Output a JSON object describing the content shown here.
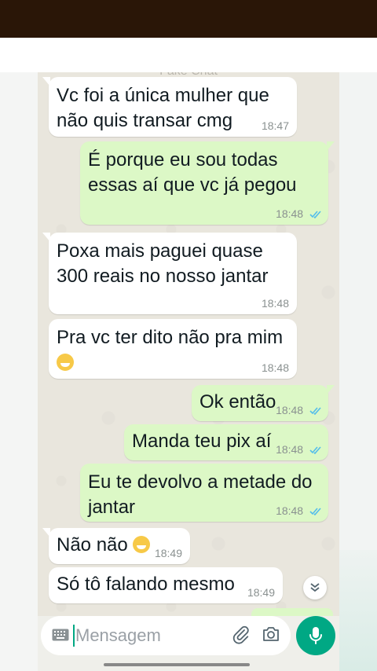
{
  "contact": {
    "name": "Fake Chat"
  },
  "messages": [
    {
      "dir": "in",
      "text": "Vc foi a única mulher que não quis transar cmg",
      "time": "18:47"
    },
    {
      "dir": "out",
      "text": "É porque eu sou todas essas aí que vc já pegou",
      "time": "18:48",
      "status": "read"
    },
    {
      "dir": "in",
      "text": "Poxa mais paguei quase 300 reais no nosso jantar",
      "time": "18:48"
    },
    {
      "dir": "in",
      "text": "Pra vc ter dito não pra mim",
      "emoji": "grinning-sweat-emoji",
      "time": "18:48"
    },
    {
      "dir": "out",
      "text": "Ok então",
      "time": "18:48",
      "status": "read"
    },
    {
      "dir": "out",
      "text": "Manda teu pix aí",
      "time": "18:48",
      "status": "read"
    },
    {
      "dir": "out",
      "text": "Eu te devolvo a metade do jantar",
      "time": "18:48",
      "status": "read"
    },
    {
      "dir": "in",
      "text": "Não não",
      "emoji": "grinning-sweat-emoji",
      "time": "18:49"
    },
    {
      "dir": "in",
      "text": "Só tô falando mesmo",
      "time": "18:49"
    }
  ],
  "composer": {
    "placeholder": "Mensagem"
  },
  "icons": {
    "keyboard": "keyboard-icon",
    "attach": "paperclip-icon",
    "camera": "camera-icon",
    "mic": "microphone-icon",
    "scroll": "chevron-double-down-icon",
    "read": "double-check-icon"
  },
  "colors": {
    "accent": "#00a884",
    "outgoing_bubble": "#dcf8c6",
    "incoming_bubble": "#ffffff",
    "read_tick": "#53bdeb",
    "chat_background": "#e9e6dd"
  }
}
